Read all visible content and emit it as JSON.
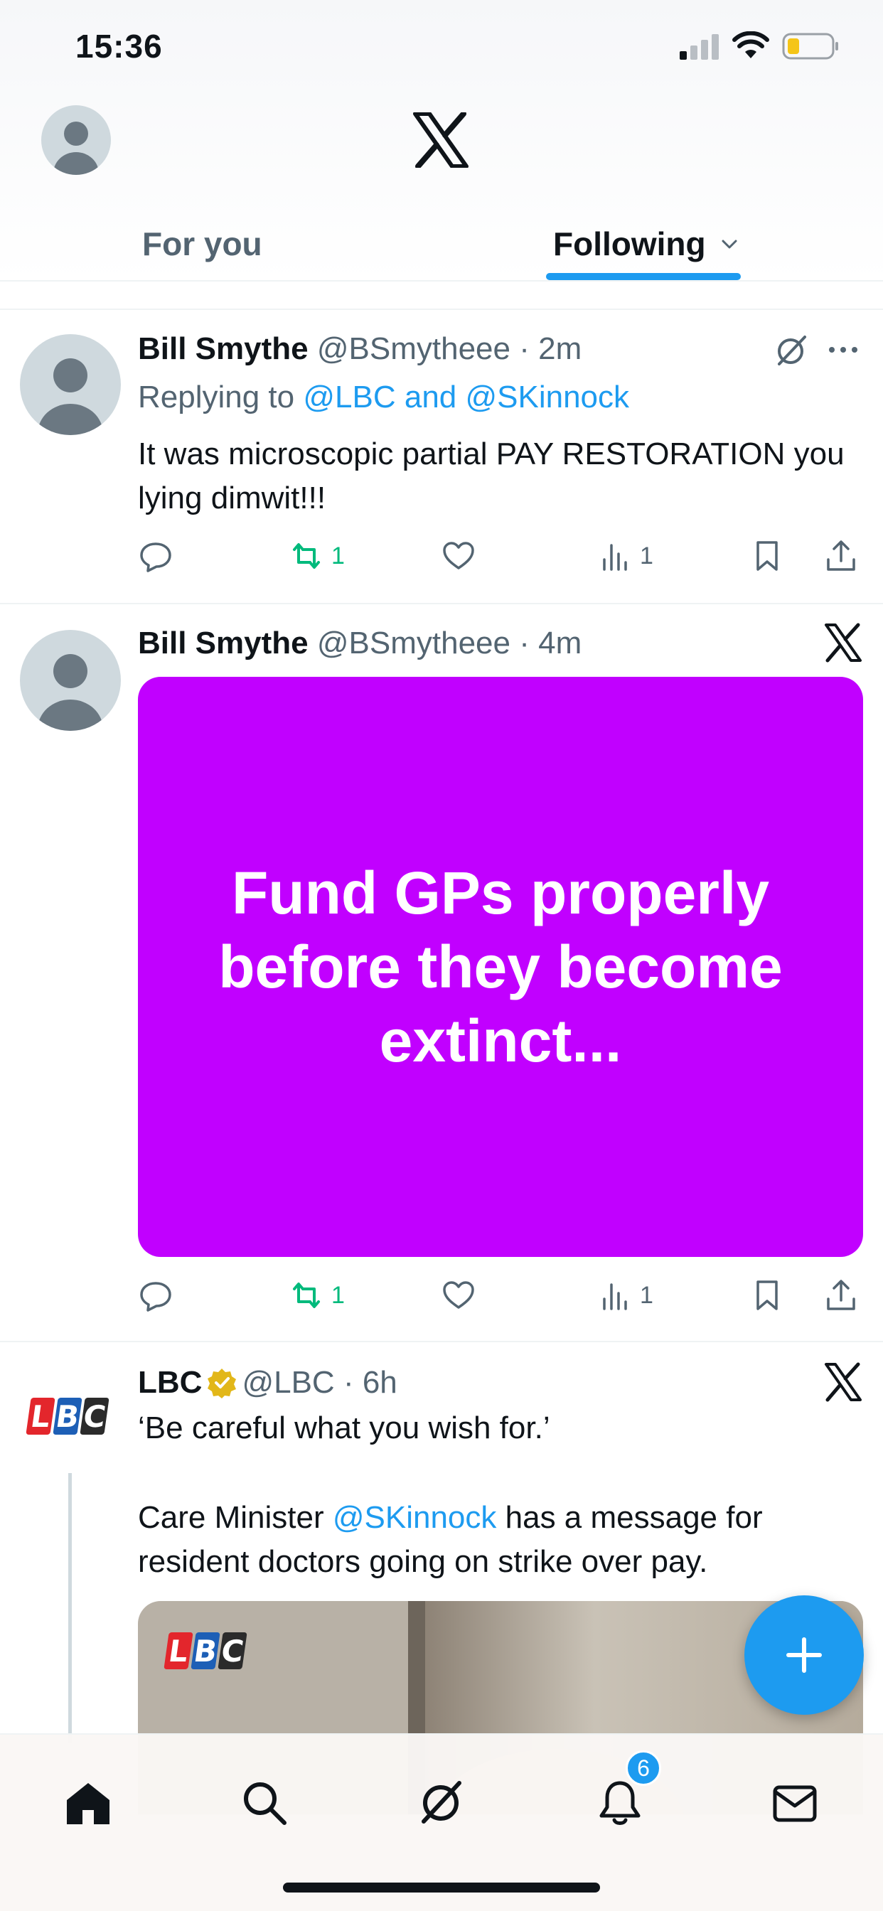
{
  "status_bar": {
    "time": "15:36"
  },
  "header": {
    "tabs": [
      {
        "label": "For you",
        "active": false
      },
      {
        "label": "Following",
        "active": true
      }
    ]
  },
  "tweets": [
    {
      "name": "Bill Smythe",
      "handle": "@BSmytheee",
      "time": "· 2m",
      "reply_prefix": "Replying to ",
      "reply_targets": "@LBC and @SKinnock",
      "text": "It was microscopic partial PAY RESTORATION you lying dimwit!!!",
      "retweets": "1",
      "views": "1"
    },
    {
      "name": "Bill Smythe",
      "handle": "@BSmytheee",
      "time": "· 4m",
      "media_text": "Fund GPs properly before they become extinct...",
      "retweets": "1",
      "views": "1"
    },
    {
      "name": "LBC",
      "handle": "@LBC",
      "time": "· 6h",
      "text_line1": "‘Be careful what you wish for.’",
      "text_pre": "Care Minister ",
      "text_mention": "@SKinnock",
      "text_post": " has a message for resident doctors going on strike over pay.",
      "logo_letters": [
        "L",
        "B",
        "C"
      ]
    }
  ],
  "tabbar": {
    "notifications_badge": "6"
  },
  "colors": {
    "accent": "#1d9bf0",
    "media_purple": "#c100ff",
    "retweet_green": "#00ba7c"
  }
}
